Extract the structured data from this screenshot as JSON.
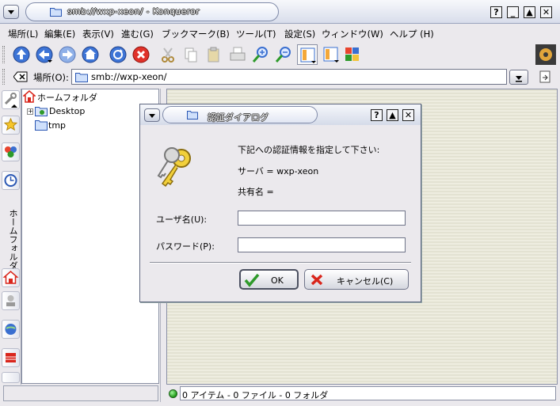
{
  "window": {
    "title": "smb://wxp-xeon/ - Konqueror",
    "buttons": {
      "help": "?",
      "minimize": "_",
      "maximize": "▲",
      "close": "✕"
    }
  },
  "menubar": {
    "items": [
      "場所(L)",
      "編集(E)",
      "表示(V)",
      "進む(G)",
      "ブックマーク(B)",
      "ツール(T)",
      "設定(S)",
      "ウィンドウ(W)",
      "ヘルプ (H)"
    ]
  },
  "toolbar": {
    "icons": [
      "up-arrow-icon",
      "back-arrow-icon",
      "forward-arrow-icon",
      "home-icon",
      "reload-icon",
      "stop-icon",
      "cut-icon",
      "copy-icon",
      "paste-icon",
      "print-icon",
      "zoom-in-icon",
      "zoom-out-icon",
      "view-mode-icon",
      "view-mode-2-icon",
      "view-mode-3-icon",
      "kde-gear-icon"
    ]
  },
  "location": {
    "label": "場所(O):",
    "value": "smb://wxp-xeon/"
  },
  "sidebar": {
    "vertical_label": "ホームフォルダ",
    "tree": {
      "root": "ホームフォルダ",
      "children": [
        "Desktop",
        "tmp"
      ]
    }
  },
  "statusbar": {
    "text": "0 アイテム - 0 ファイル - 0 フォルダ"
  },
  "dialog": {
    "title": "認証ダイアログ",
    "message": "下記への認証情報を指定して下さい:",
    "server_line": "サーバ = wxp-xeon",
    "share_line": "共有名 =",
    "username_label": "ユーザ名(U):",
    "username_value": "",
    "password_label": "パスワード(P):",
    "password_value": "",
    "ok_label": "OK",
    "cancel_label": "キャンセル(C)",
    "buttons": {
      "help": "?",
      "maximize": "▲",
      "close": "✕"
    }
  },
  "colors": {
    "ok_check": "#2e9a2a",
    "cancel_x": "#d9261c",
    "toolbar_blue": "#2f64c8"
  }
}
